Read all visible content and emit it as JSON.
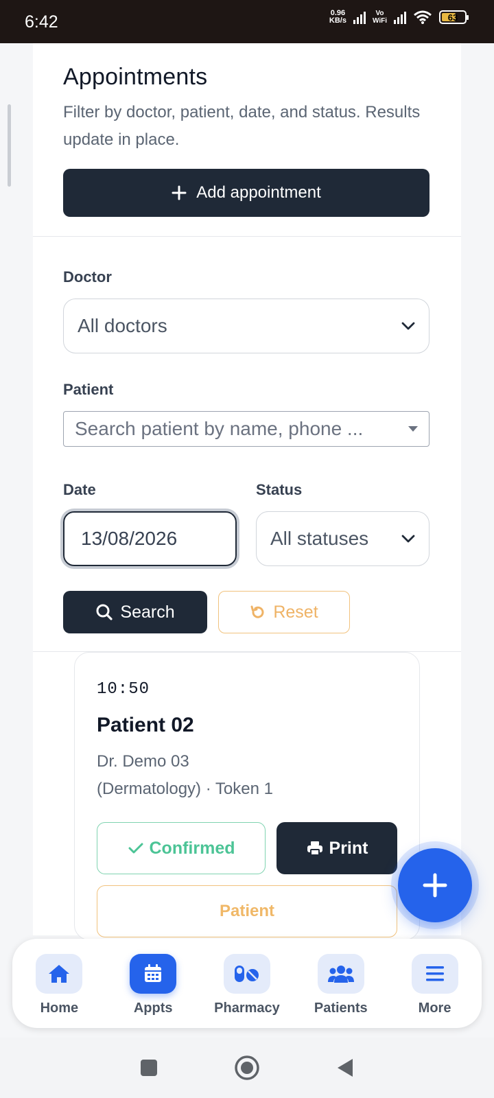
{
  "status_bar": {
    "time": "6:42",
    "net_speed_value": "0.96",
    "net_speed_unit": "KB/s",
    "volte_top": "Vo",
    "volte_bottom": "WiFi",
    "battery": "63"
  },
  "header": {
    "title": "Appointments",
    "subtitle": "Filter by doctor, patient, date, and status. Results update in place.",
    "add_button": "Add appointment"
  },
  "filters": {
    "doctor_label": "Doctor",
    "doctor_value": "All doctors",
    "patient_label": "Patient",
    "patient_placeholder": "Search patient by name, phone ...",
    "date_label": "Date",
    "date_value": "13/08/2026",
    "status_label": "Status",
    "status_value": "All statuses",
    "search_button": "Search",
    "reset_button": "Reset"
  },
  "appointment": {
    "time": "10:50",
    "patient_name": "Patient 02",
    "doctor_line1": "Dr. Demo 03",
    "doctor_line2": "(Dermatology) · Token 1",
    "status_button": "Confirmed",
    "print_button": "Print",
    "patient_button": "Patient"
  },
  "bottom_nav": {
    "items": [
      {
        "label": "Home",
        "icon": "home-icon"
      },
      {
        "label": "Appts",
        "icon": "calendar-icon",
        "active": true
      },
      {
        "label": "Pharmacy",
        "icon": "pills-icon"
      },
      {
        "label": "Patients",
        "icon": "users-icon"
      },
      {
        "label": "More",
        "icon": "menu-icon"
      }
    ]
  },
  "colors": {
    "primary": "#2563eb",
    "dark": "#1f2937",
    "confirmed": "#4cc496",
    "warning": "#f0b868"
  }
}
